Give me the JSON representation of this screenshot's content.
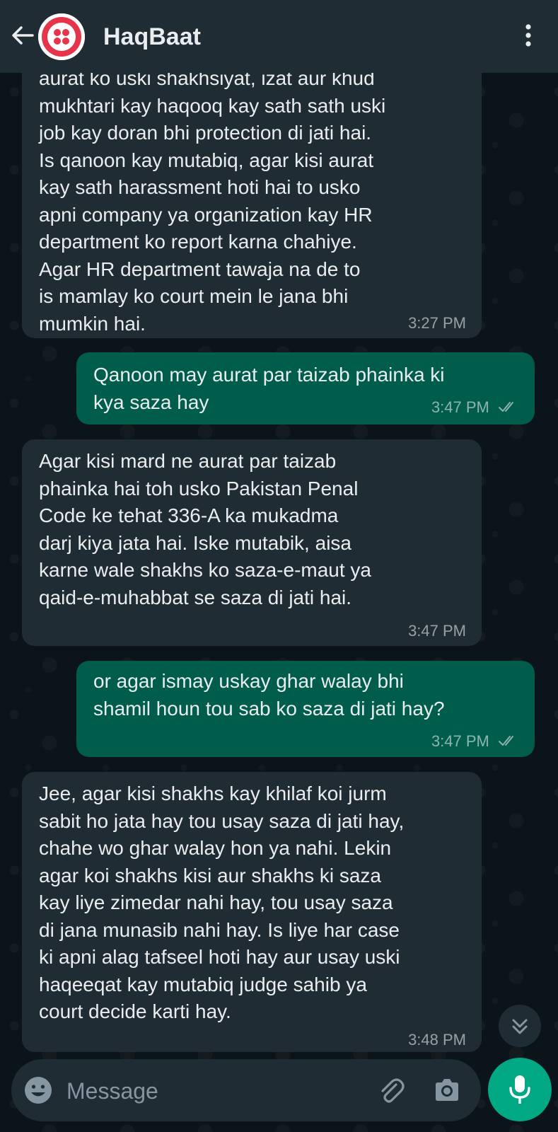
{
  "header": {
    "title": "HaqBaat",
    "back_icon": "arrow-left-icon",
    "avatar_icon": "haqbaat-logo",
    "menu_icon": "more-vertical-icon"
  },
  "messages": [
    {
      "direction": "incoming",
      "text": "aurat ko uski shakhsiyat, izat aur khud\nmukhtari kay haqooq kay sath sath uski\njob kay doran bhi protection di jati hai.\nIs qanoon kay mutabiq, agar kisi aurat\nkay sath harassment hoti hai to usko\napni company ya organization kay HR\ndepartment ko report karna chahiye.\nAgar HR department tawaja na de to\nis mamlay ko court mein le jana bhi\nmumkin hai.",
      "time": "3:27 PM"
    },
    {
      "direction": "outgoing",
      "text": "Qanoon may aurat par taizab phainka ki\nkya saza hay",
      "time": "3:47 PM",
      "status": "read-ticks"
    },
    {
      "direction": "incoming",
      "text": "Agar kisi mard ne aurat par taizab\nphainka hai toh usko Pakistan Penal\nCode ke tehat 336-A ka mukadma\ndarj kiya jata hai. Iske mutabik, aisa\nkarne wale shakhs ko saza-e-maut ya\nqaid-e-muhabbat se saza di jati hai.",
      "time": "3:47 PM"
    },
    {
      "direction": "outgoing",
      "text": "or agar ismay uskay ghar walay bhi\nshamil houn tou sab ko saza di jati hay?",
      "time": "3:47 PM",
      "status": "read-ticks"
    },
    {
      "direction": "incoming",
      "text": "Jee, agar kisi shakhs kay khilaf koi jurm\nsabit ho jata hay tou usay saza di jati hay,\nchahe wo ghar walay hon ya nahi. Lekin\nagar koi shakhs kisi aur shakhs ki saza\nkay liye zimedar nahi hay, tou usay saza\ndi jana munasib nahi hay. Is liye har case\nki apni alag tafseel hoti hay aur usay uski\nhaqeeqat kay mutabiq judge sahib ya\ncourt decide karti hay.",
      "time": "3:48 PM"
    }
  ],
  "composer": {
    "placeholder": "Message",
    "emoji_icon": "emoji-icon",
    "attach_icon": "paperclip-icon",
    "camera_icon": "camera-icon",
    "mic_icon": "microphone-icon",
    "scroll_icon": "chevrons-down-icon"
  },
  "colors": {
    "background": "#0b141a",
    "header": "#1f2c34",
    "incoming_bubble": "#1f2c34",
    "outgoing_bubble": "#005c4b",
    "accent": "#00a884",
    "logo_red": "#e6354a"
  }
}
